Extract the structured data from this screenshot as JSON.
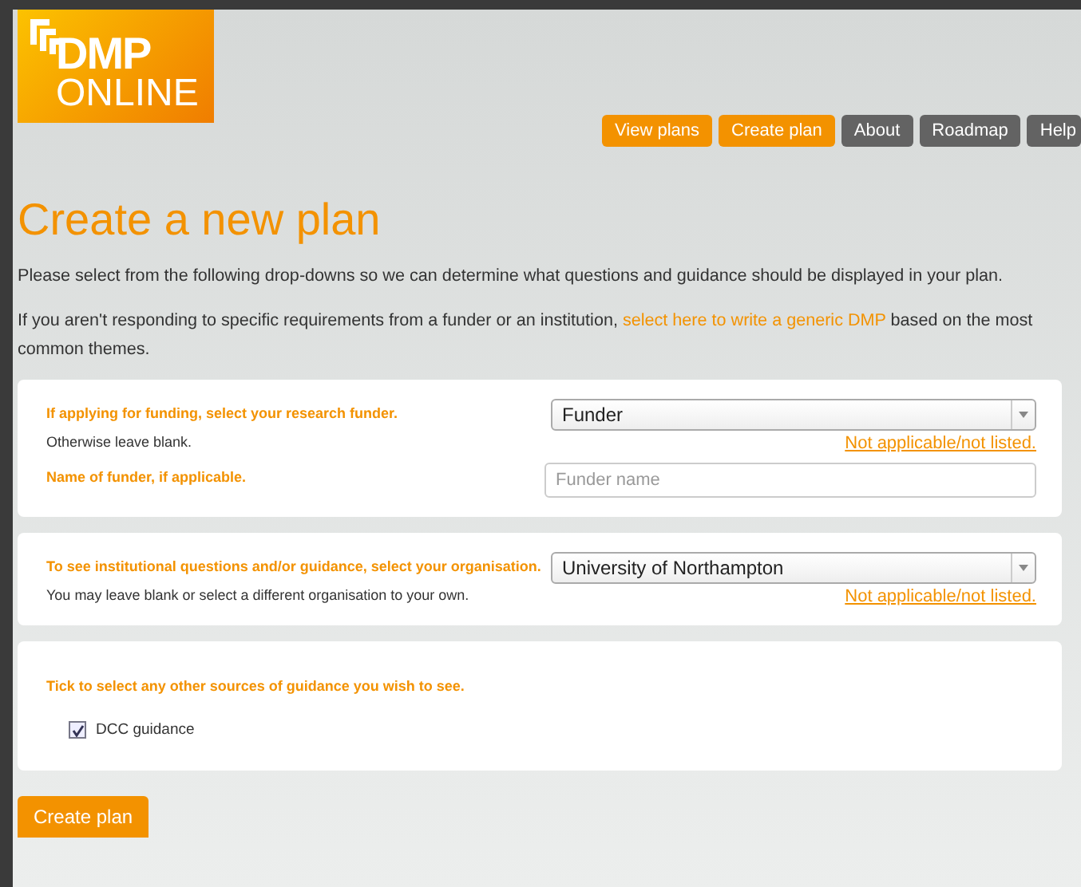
{
  "logo": {
    "line_1": "DMP",
    "line_2": "ONLINE"
  },
  "nav": [
    {
      "label": "View plans",
      "kind": "primary"
    },
    {
      "label": "Create plan",
      "kind": "primary"
    },
    {
      "label": "About",
      "kind": "secondary"
    },
    {
      "label": "Roadmap",
      "kind": "secondary"
    },
    {
      "label": "Help",
      "kind": "secondary"
    }
  ],
  "title": "Create a new plan",
  "intro": "Please select from the following drop-downs so we can determine what questions and guidance should be displayed in your plan.",
  "generic": {
    "before": "If you aren't responding to specific requirements from a funder or an institution, ",
    "link": "select here to write a generic DMP",
    "after": " based on the most common themes."
  },
  "funder_panel": {
    "label": "If applying for funding, select your research funder.",
    "hint": "Otherwise leave blank.",
    "select": "Funder",
    "link": "Not applicable/not listed.",
    "name_label": "Name of funder, if applicable.",
    "name_placeholder": "Funder name"
  },
  "org_panel": {
    "label": "To see institutional questions and/or guidance, select your organisation.",
    "hint": "You may leave blank or select a different organisation to your own.",
    "select": "University of Northampton",
    "link": "Not applicable/not listed."
  },
  "guidance_panel": {
    "label": "Tick to select any other sources of guidance you wish to see.",
    "options": [
      {
        "label": "DCC guidance",
        "checked": true
      }
    ]
  },
  "submit": "Create plan"
}
